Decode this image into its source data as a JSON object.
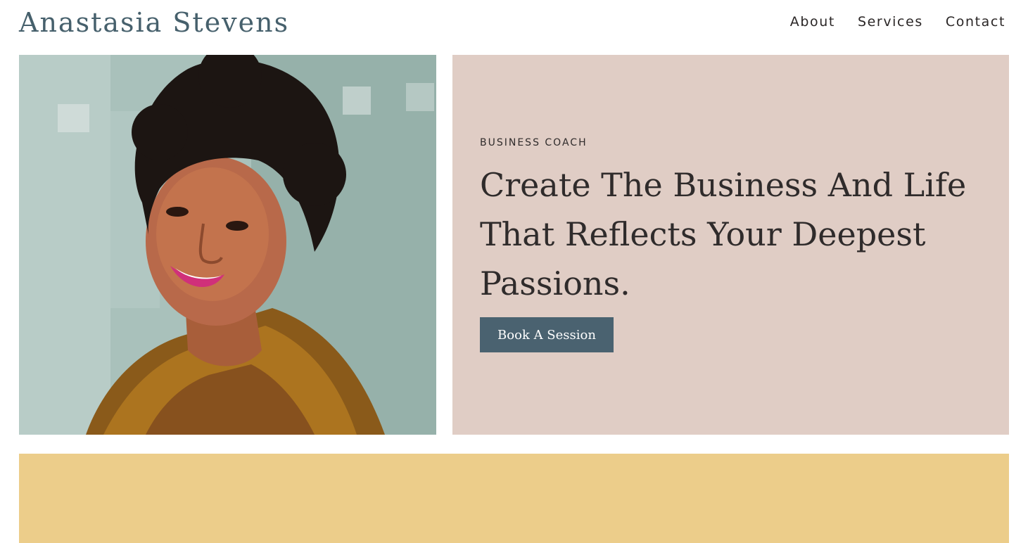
{
  "header": {
    "site_title": "Anastasia Stevens",
    "nav": [
      {
        "label": "About"
      },
      {
        "label": "Services"
      },
      {
        "label": "Contact"
      }
    ]
  },
  "hero": {
    "eyebrow": "BUSINESS COACH",
    "headline": "Create The Business And Life That Reflects Your Deepest Passions.",
    "cta_label": "Book A Session"
  },
  "colors": {
    "brand": "#46606c",
    "hero_background": "#e0cdc5",
    "button_background": "#4a6270",
    "band_background": "#eccd8a"
  }
}
